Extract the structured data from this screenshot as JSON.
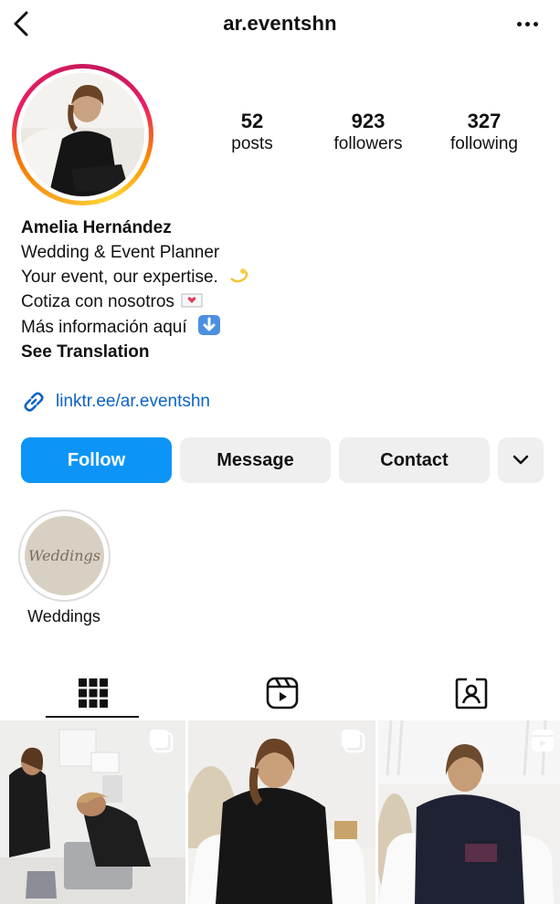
{
  "header": {
    "username": "ar.eventshn",
    "back_icon": "chevron-left-icon",
    "more_icon": "more-horizontal-icon"
  },
  "stats": [
    {
      "count": "52",
      "label": "posts"
    },
    {
      "count": "923",
      "label": "followers"
    },
    {
      "count": "327",
      "label": "following"
    }
  ],
  "bio": {
    "name": "Amelia Hernández",
    "lines": [
      "Wedding & Event Planner",
      "Your event, our expertise.",
      "Cotiza con nosotros",
      "Más información aquí"
    ],
    "see_translation": "See Translation"
  },
  "link": {
    "text": "linktr.ee/ar.eventshn",
    "icon": "link-icon"
  },
  "actions": {
    "follow": "Follow",
    "message": "Message",
    "contact": "Contact",
    "more_icon": "chevron-down-icon"
  },
  "highlights": [
    {
      "label": "Weddings",
      "cover_text": "Weddings"
    }
  ],
  "tabs": [
    "grid-icon",
    "reels-icon",
    "tagged-icon"
  ],
  "colors": {
    "accent": "#0c95f6",
    "link": "#0b63c7",
    "button_bg": "#efefef"
  }
}
